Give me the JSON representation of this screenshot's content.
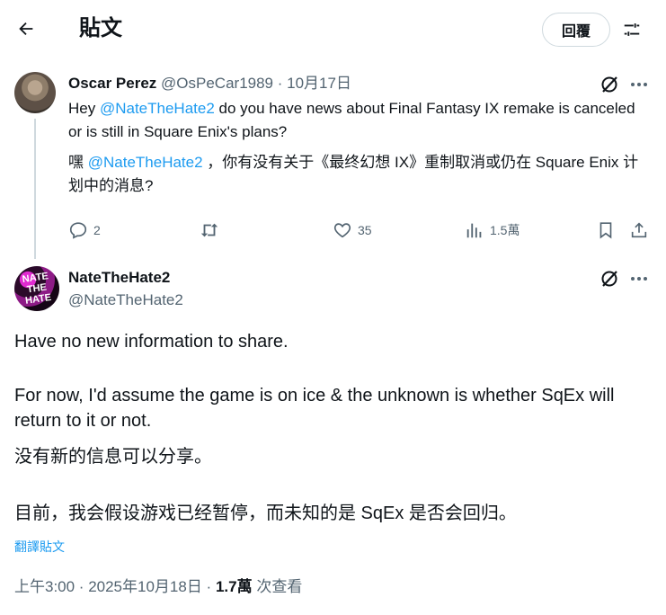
{
  "header": {
    "title": "貼文",
    "reply_label": "回覆"
  },
  "parent": {
    "display_name": "Oscar Perez",
    "handle_date": "@OsPeCar1989 · 10月17日",
    "line1_pre": "Hey ",
    "line1_mention": "@NateTheHate2",
    "line1_post": " do you have news about Final Fantasy IX remake is canceled or is still in Square Enix's plans?",
    "line2_pre": "嘿 ",
    "line2_mention": "@NateTheHate2",
    "line2_post": " ，你有没有关于《最终幻想 IX》重制取消或仍在 Square Enix 计划中的消息?",
    "replies": "2",
    "likes": "35",
    "views": "1.5萬"
  },
  "main": {
    "display_name": "NateTheHate2",
    "handle": "@NateTheHate2",
    "avatar_text": "NATE THE HATE",
    "p1": "Have no new information to share.",
    "p2": "For now, I'd assume the game is on ice & the unknown is whether SqEx will return to it or not.",
    "p3": "没有新的信息可以分享。",
    "p4": "目前，我会假设游戏已经暂停，而未知的是 SqEx 是否会回归。",
    "translate_label": "翻譯貼文",
    "time_date": "上午3:00 · 2025年10月18日 · ",
    "views_count": "1.7萬",
    "views_label": " 次查看"
  },
  "colors": {
    "accent": "#1d9bf0",
    "secondary": "#536471",
    "border": "#cfd9de"
  },
  "icons": [
    "back-arrow-icon",
    "sliders-icon",
    "grok-icon",
    "more-icon",
    "reply-icon",
    "repost-icon",
    "like-icon",
    "views-icon",
    "bookmark-icon",
    "share-icon"
  ]
}
